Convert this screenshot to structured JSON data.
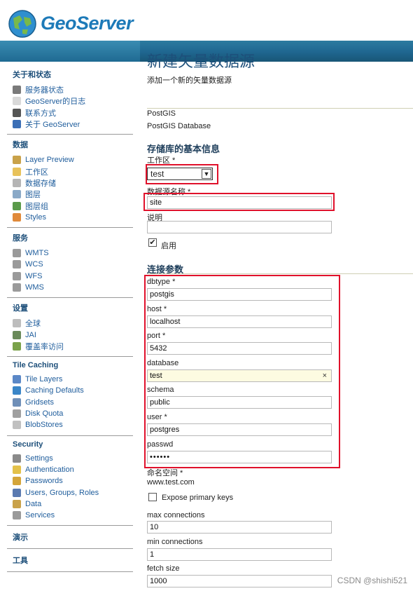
{
  "app": {
    "name": "GeoServer"
  },
  "colors": {
    "header_bar": "#1f6690",
    "link": "#1f5d9c",
    "heading": "#1d4f7a",
    "highlight_box": "#e0112b"
  },
  "sidebar": {
    "sections": [
      {
        "title": "关于和状态",
        "items": [
          {
            "label": "服务器状态",
            "icon": "server-status-icon"
          },
          {
            "label": "GeoServer的日志",
            "icon": "log-icon"
          },
          {
            "label": "联系方式",
            "icon": "contact-icon"
          },
          {
            "label": "关于 GeoServer",
            "icon": "info-icon"
          }
        ]
      },
      {
        "title": "数据",
        "items": [
          {
            "label": "Layer Preview",
            "icon": "layer-preview-icon"
          },
          {
            "label": "工作区",
            "icon": "folder-icon"
          },
          {
            "label": "数据存储",
            "icon": "database-icon"
          },
          {
            "label": "图层",
            "icon": "layer-icon"
          },
          {
            "label": "图层组",
            "icon": "layer-group-icon"
          },
          {
            "label": "Styles",
            "icon": "palette-icon"
          }
        ]
      },
      {
        "title": "服务",
        "items": [
          {
            "label": "WMTS",
            "icon": "service-icon"
          },
          {
            "label": "WCS",
            "icon": "service-icon"
          },
          {
            "label": "WFS",
            "icon": "service-icon"
          },
          {
            "label": "WMS",
            "icon": "service-icon"
          }
        ]
      },
      {
        "title": "设置",
        "items": [
          {
            "label": "全球",
            "icon": "global-settings-icon"
          },
          {
            "label": "JAI",
            "icon": "jai-icon"
          },
          {
            "label": "覆盖率访问",
            "icon": "coverage-icon"
          }
        ]
      },
      {
        "title": "Tile Caching",
        "items": [
          {
            "label": "Tile Layers",
            "icon": "tile-layers-icon"
          },
          {
            "label": "Caching Defaults",
            "icon": "globe-icon"
          },
          {
            "label": "Gridsets",
            "icon": "grid-icon"
          },
          {
            "label": "Disk Quota",
            "icon": "disk-icon"
          },
          {
            "label": "BlobStores",
            "icon": "blobstore-icon"
          }
        ]
      },
      {
        "title": "Security",
        "items": [
          {
            "label": "Settings",
            "icon": "wrench-icon"
          },
          {
            "label": "Authentication",
            "icon": "shield-icon"
          },
          {
            "label": "Passwords",
            "icon": "lock-icon"
          },
          {
            "label": "Users, Groups, Roles",
            "icon": "users-icon"
          },
          {
            "label": "Data",
            "icon": "data-security-icon"
          },
          {
            "label": "Services",
            "icon": "services-security-icon"
          }
        ]
      },
      {
        "title": "演示",
        "items": []
      },
      {
        "title": "工具",
        "items": []
      }
    ]
  },
  "main": {
    "title": "新建矢量数据源",
    "subtitle": "添加一个新的矢量数据源",
    "store_type": "PostGIS",
    "store_desc": "PostGIS Database",
    "basic_section": "存储库的基本信息",
    "workspace_label": "工作区 *",
    "workspace_value": "test",
    "datasource_label": "数据源名称 *",
    "datasource_value": "site",
    "description_label": "说明",
    "description_value": "",
    "enabled_label": "启用",
    "enabled_checked": true,
    "conn_section": "连接参数",
    "params": [
      {
        "label": "dbtype *",
        "value": "postgis"
      },
      {
        "label": "host *",
        "value": "localhost"
      },
      {
        "label": "port *",
        "value": "5432"
      },
      {
        "label": "database",
        "value": "test"
      },
      {
        "label": "schema",
        "value": "public"
      },
      {
        "label": "user *",
        "value": "postgres"
      },
      {
        "label": "passwd",
        "value": "••••••"
      }
    ],
    "namespace_label": "命名空间 *",
    "namespace_value": "www.test.com",
    "expose_pk_label": "Expose primary keys",
    "expose_pk_checked": false,
    "max_conn_label": "max connections",
    "max_conn_value": "10",
    "min_conn_label": "min connections",
    "min_conn_value": "1",
    "fetch_size_label": "fetch size",
    "fetch_size_value": "1000"
  },
  "watermark": "CSDN @shishi521"
}
